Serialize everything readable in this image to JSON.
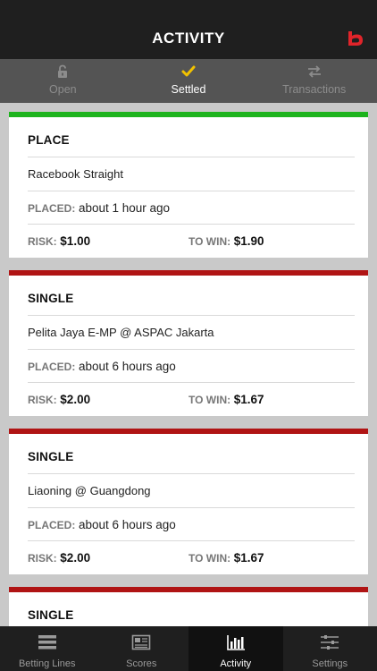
{
  "header": {
    "title": "ACTIVITY",
    "logo_icon": "b-logo-icon",
    "brand_color": "#e0242a"
  },
  "tabs": [
    {
      "label": "Open",
      "icon": "unlock-icon"
    },
    {
      "label": "Settled",
      "icon": "check-icon",
      "active": true
    },
    {
      "label": "Transactions",
      "icon": "swap-arrows-icon"
    }
  ],
  "bets": [
    {
      "type": "PLACE",
      "event": "Racebook Straight",
      "placed_label": "PLACED:",
      "placed": "about 1 hour ago",
      "risk_label": "RISK:",
      "risk": "$1.00",
      "win_label": "TO WIN:",
      "win": "$1.90",
      "status_color": "#1db31d"
    },
    {
      "type": "SINGLE",
      "event": "Pelita Jaya E-MP @ ASPAC Jakarta",
      "placed_label": "PLACED:",
      "placed": "about 6 hours ago",
      "risk_label": "RISK:",
      "risk": "$2.00",
      "win_label": "TO WIN:",
      "win": "$1.67",
      "status_color": "#b01414"
    },
    {
      "type": "SINGLE",
      "event": "Liaoning @ Guangdong",
      "placed_label": "PLACED:",
      "placed": "about 6 hours ago",
      "risk_label": "RISK:",
      "risk": "$2.00",
      "win_label": "TO WIN:",
      "win": "$1.67",
      "status_color": "#b01414"
    },
    {
      "type": "SINGLE",
      "status_color": "#b01414"
    }
  ],
  "tabbar": [
    {
      "label": "Betting Lines",
      "icon": "list-icon"
    },
    {
      "label": "Scores",
      "icon": "newspaper-icon"
    },
    {
      "label": "Activity",
      "icon": "bar-chart-icon",
      "active": true
    },
    {
      "label": "Settings",
      "icon": "sliders-icon"
    }
  ]
}
